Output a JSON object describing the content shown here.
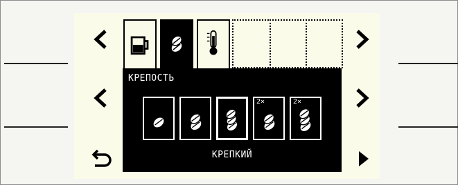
{
  "panel": {
    "title": "КРЕПОСТЬ",
    "value": "КРЕПКИЙ",
    "options": [
      {
        "beans": 1,
        "multiplier": ""
      },
      {
        "beans": 2,
        "multiplier": ""
      },
      {
        "beans": 3,
        "multiplier": "",
        "selected": true
      },
      {
        "beans": 2,
        "multiplier": "2×"
      },
      {
        "beans": 3,
        "multiplier": "2×"
      }
    ]
  },
  "tabs": [
    {
      "icon": "cup-icon",
      "state": "normal"
    },
    {
      "icon": "coffee-bean-icon",
      "state": "active"
    },
    {
      "icon": "thermometer-icon",
      "state": "normal"
    },
    {
      "icon": "",
      "state": "empty"
    },
    {
      "icon": "",
      "state": "empty"
    },
    {
      "icon": "",
      "state": "empty"
    }
  ],
  "controls": {
    "left_top_icon": "chevron-left-icon",
    "right_top_icon": "chevron-right-icon",
    "left_mid_icon": "chevron-left-icon",
    "right_mid_icon": "chevron-right-icon",
    "back_icon": "back-arrow-icon",
    "play_icon": "play-triangle-icon"
  }
}
